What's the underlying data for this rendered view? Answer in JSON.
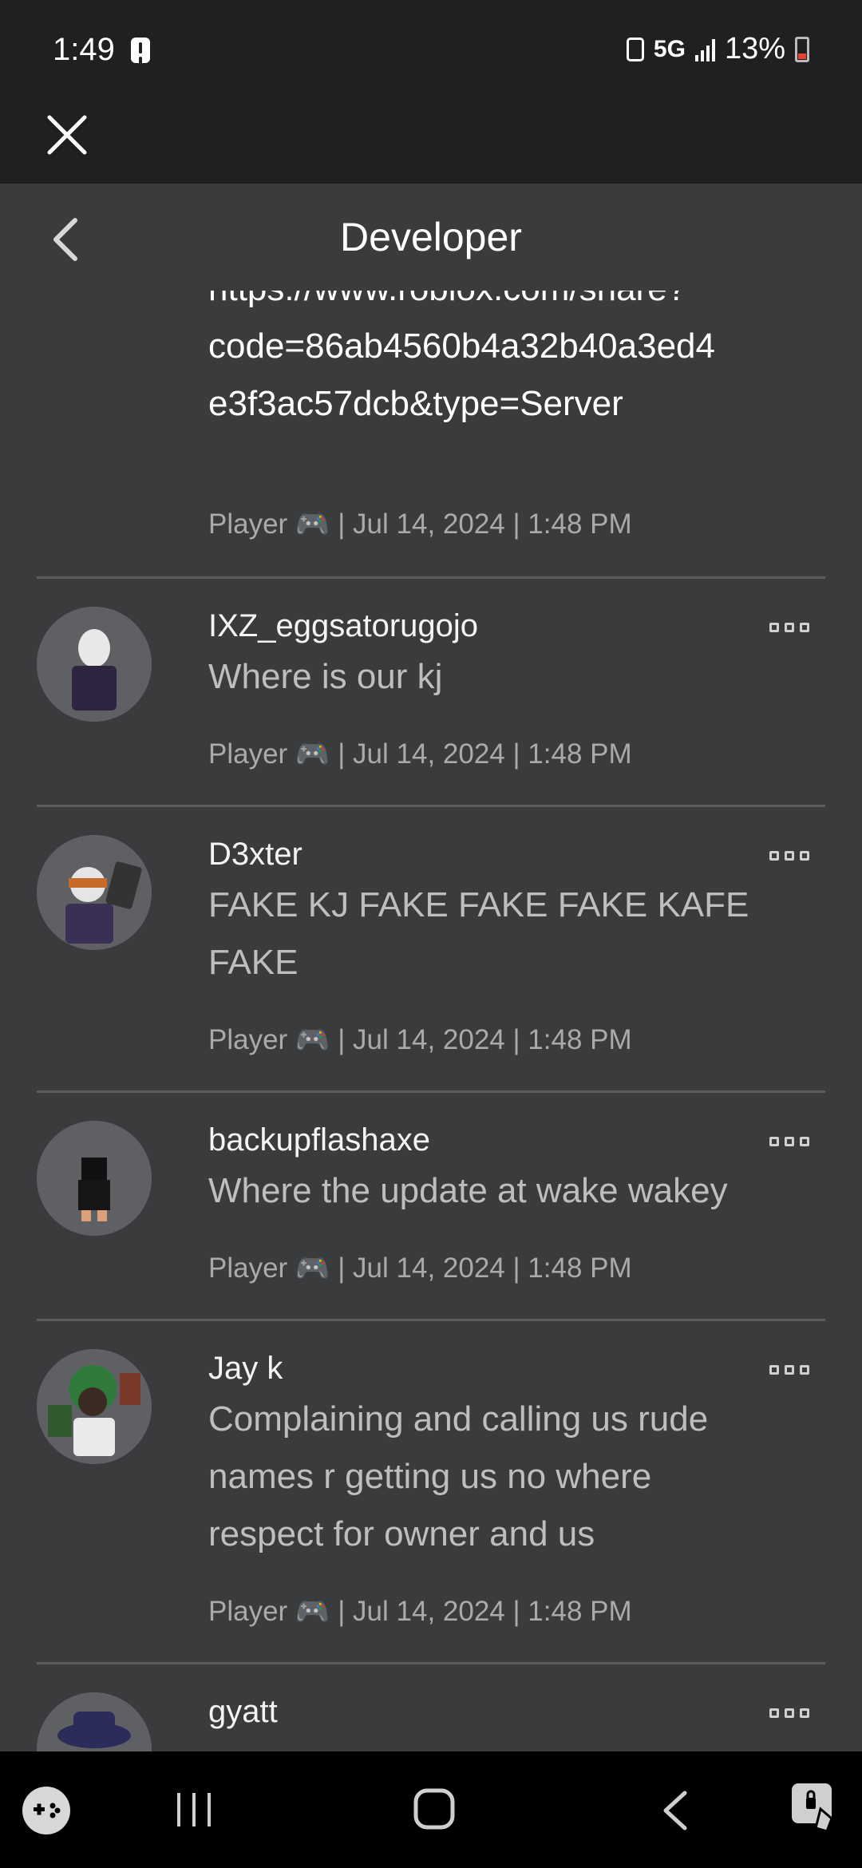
{
  "status": {
    "time": "1:49",
    "network": "5G",
    "battery": "13%"
  },
  "header": {
    "title": "Developer"
  },
  "top_message": {
    "text_lines": [
      "https://www.roblox.com/share?",
      "code=86ab4560b4a32b40a3ed4",
      "e3f3ac57dcb&type=Server"
    ],
    "meta": "Player 🎮 | Jul 14, 2024 | 1:48 PM"
  },
  "posts": [
    {
      "username": "IXZ_eggsatorugojo",
      "lines": [
        "Where is our kj"
      ],
      "meta": "Player 🎮 | Jul 14, 2024 | 1:48 PM"
    },
    {
      "username": "D3xter",
      "lines": [
        "FAKE KJ FAKE FAKE FAKE KAFE",
        "FAKE"
      ],
      "meta": "Player 🎮 | Jul 14, 2024 | 1:48 PM"
    },
    {
      "username": "backupflashaxe",
      "lines": [
        "Where the update at wake wakey"
      ],
      "meta": "Player 🎮 | Jul 14, 2024 | 1:48 PM"
    },
    {
      "username": "Jay k",
      "lines": [
        "Complaining and calling us rude",
        "names r getting us no where",
        "respect for owner and us"
      ],
      "meta": "Player 🎮 | Jul 14, 2024 | 1:48 PM"
    },
    {
      "username": "gyatt",
      "lines": [],
      "meta": ""
    }
  ],
  "meta_parts": {
    "role": "Player",
    "date": "Jul 14, 2024",
    "time": "1:48 PM"
  }
}
